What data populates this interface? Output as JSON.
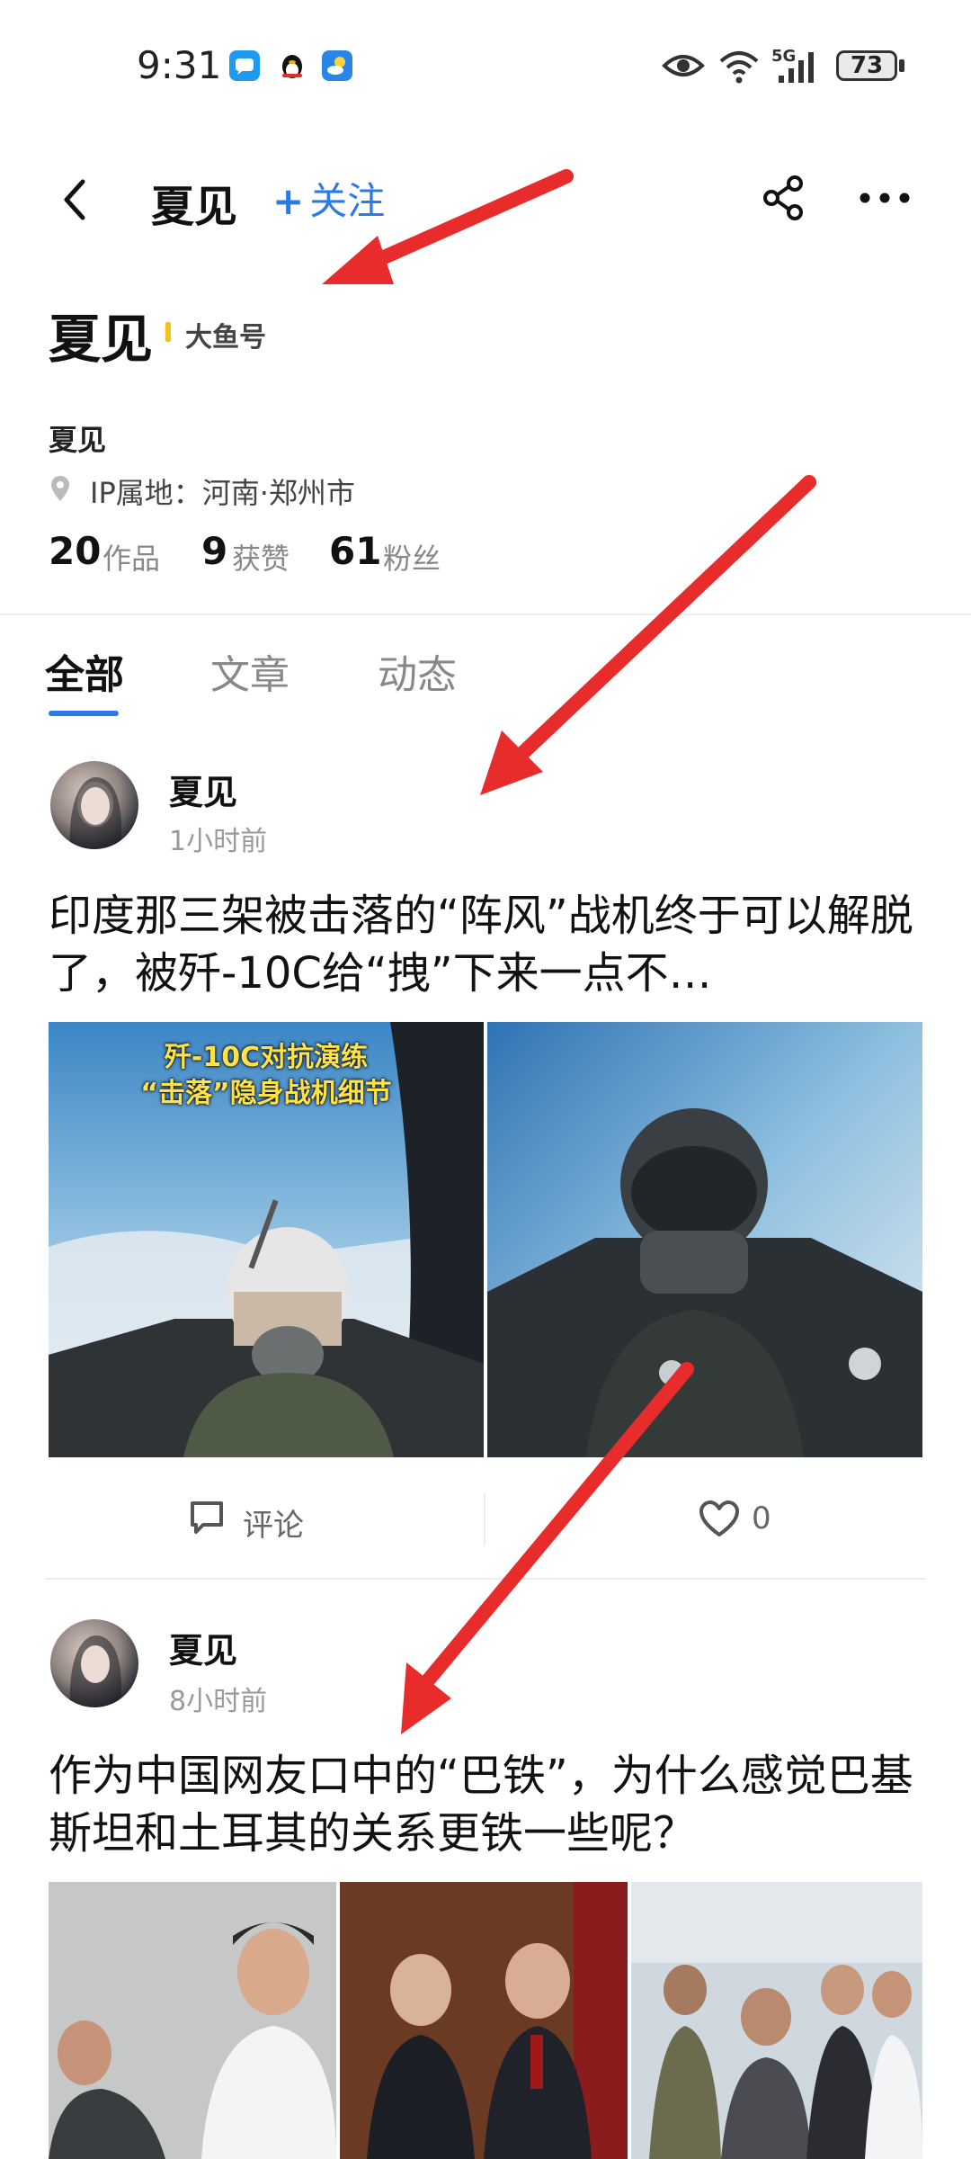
{
  "status_bar": {
    "time": "9:31",
    "signal_label": "5G",
    "battery": "73"
  },
  "header": {
    "title": "夏见",
    "follow_label": "关注"
  },
  "profile": {
    "name": "夏见",
    "badge": "大鱼号",
    "subtitle": "夏见",
    "ip_location": "IP属地：河南·郑州市",
    "stats": [
      {
        "value": "20",
        "label": "作品"
      },
      {
        "value": "9",
        "label": "获赞"
      },
      {
        "value": "61",
        "label": "粉丝"
      }
    ]
  },
  "tabs": [
    {
      "label": "全部",
      "active": true
    },
    {
      "label": "文章",
      "active": false
    },
    {
      "label": "动态",
      "active": false
    }
  ],
  "posts": [
    {
      "author": "夏见",
      "time": "1小时前",
      "title": "印度那三架被击落的“阵风”战机终于可以解脱了，被歼-10C给“拽”下来一点不…",
      "image_caption_line1": "歼-10C对抗演练",
      "image_caption_line2": "“击落”隐身战机细节",
      "comment_label": "评论",
      "like_count": "0"
    },
    {
      "author": "夏见",
      "time": "8小时前",
      "title": "作为中国网友口中的“巴铁”，为什么感觉巴基斯坦和土耳其的关系更铁一些呢？"
    }
  ],
  "colors": {
    "accent": "#2a7be4",
    "badge_bar": "#f4c21b",
    "arrow": "#e82b2b",
    "caption": "#ffe14a"
  }
}
